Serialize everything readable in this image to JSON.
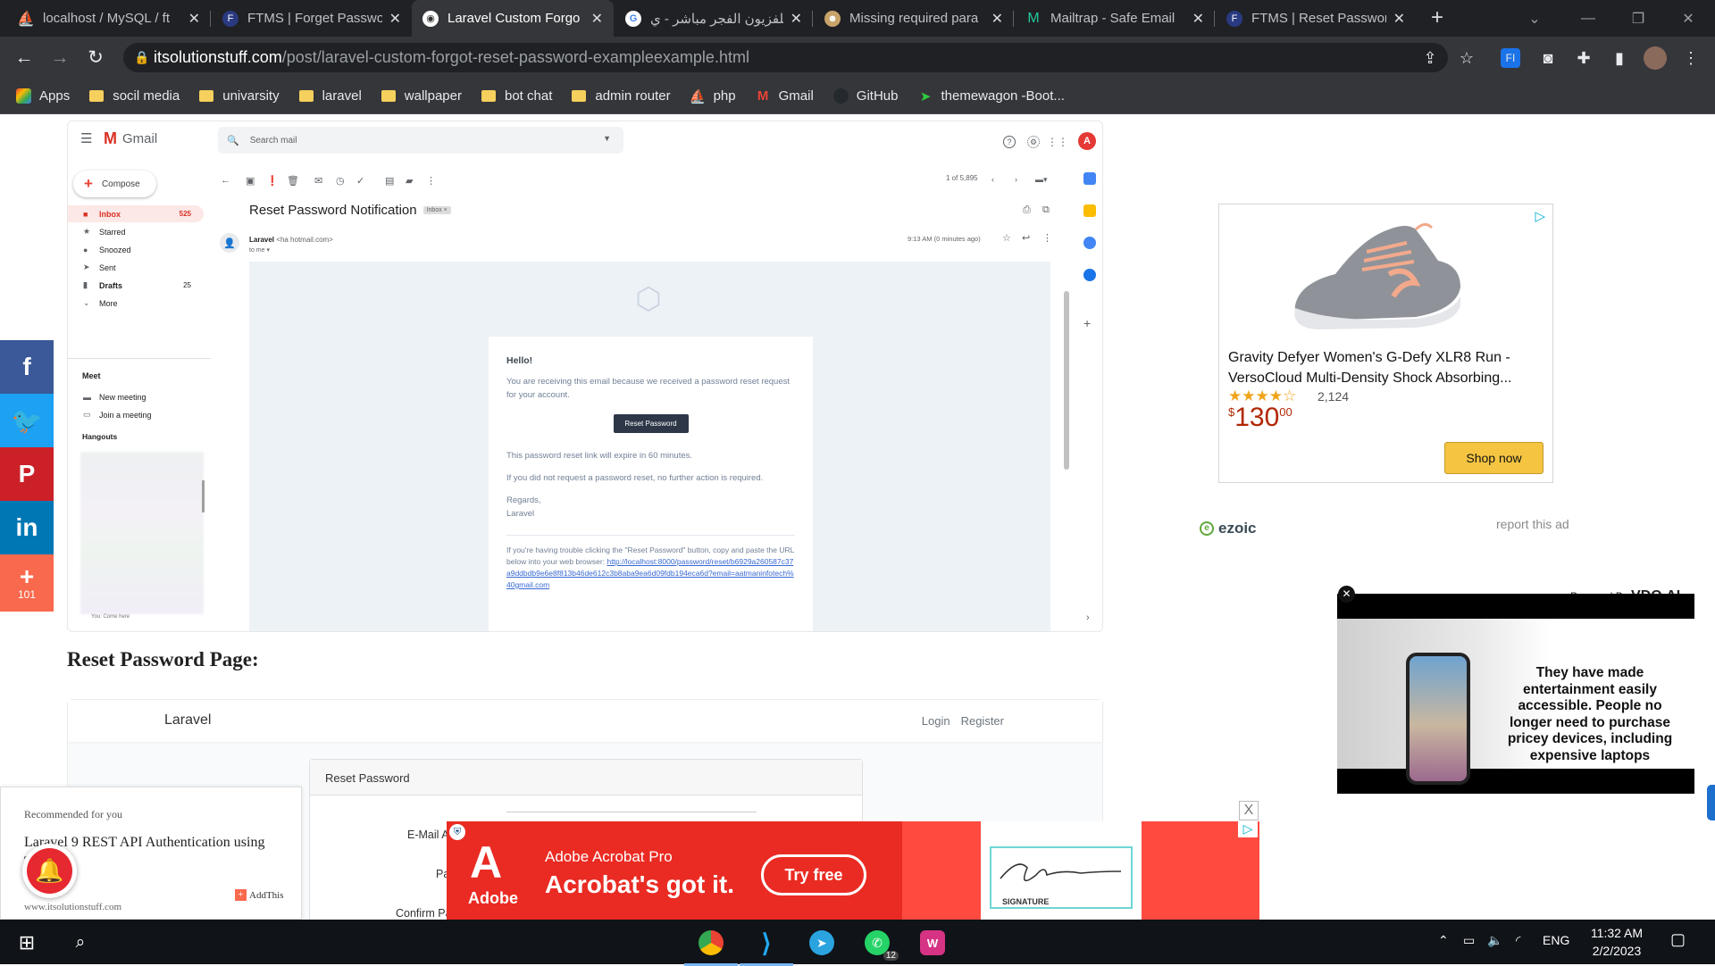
{
  "browser": {
    "tabs": [
      {
        "label": "localhost / MySQL / ft",
        "icon": "phpmyadmin-icon"
      },
      {
        "label": "FTMS | Forget Passwo",
        "icon": "ftms-icon"
      },
      {
        "label": "Laravel Custom Forgo",
        "icon": "itsolution-icon",
        "active": true
      },
      {
        "label": "تلفزيون الفجر مباشر - ي",
        "icon": "google-icon"
      },
      {
        "label": "Missing required para",
        "icon": "site-icon"
      },
      {
        "label": "Mailtrap - Safe Email",
        "icon": "mailtrap-icon"
      },
      {
        "label": "FTMS | Reset Passwor",
        "icon": "ftms-icon"
      }
    ],
    "url_host": "itsolutionstuff.com",
    "url_path": "/post/laravel-custom-forgot-reset-password-exampleexample.html",
    "bookmarks": [
      {
        "label": "Apps",
        "icon": "apps-grid-icon"
      },
      {
        "label": "socil media",
        "icon": "folder-icon"
      },
      {
        "label": "univarsity",
        "icon": "folder-icon"
      },
      {
        "label": "laravel",
        "icon": "folder-icon"
      },
      {
        "label": "wallpaper",
        "icon": "folder-icon"
      },
      {
        "label": "bot chat",
        "icon": "folder-icon"
      },
      {
        "label": "admin router",
        "icon": "folder-icon"
      },
      {
        "label": "php",
        "icon": "phpmyadmin-icon"
      },
      {
        "label": "Gmail",
        "icon": "gmail-icon"
      },
      {
        "label": "GitHub",
        "icon": "github-icon"
      },
      {
        "label": "themewagon -Boot...",
        "icon": "themewagon-icon"
      }
    ]
  },
  "share": {
    "plus_count": "101"
  },
  "gmail": {
    "app_name": "Gmail",
    "search_placeholder": "Search mail",
    "compose": "Compose",
    "nav": [
      {
        "label": "Inbox",
        "count": "525",
        "icon": "inbox-icon"
      },
      {
        "label": "Starred",
        "count": "",
        "icon": "star-icon"
      },
      {
        "label": "Snoozed",
        "count": "",
        "icon": "clock-icon"
      },
      {
        "label": "Sent",
        "count": "",
        "icon": "send-icon"
      },
      {
        "label": "Drafts",
        "count": "25",
        "icon": "draft-icon"
      },
      {
        "label": "More",
        "count": "",
        "icon": "chevron-down-icon"
      }
    ],
    "meet_title": "Meet",
    "meet_items": [
      "New meeting",
      "Join a meeting"
    ],
    "hangouts_title": "Hangouts",
    "hangouts_footer": "You: Come here",
    "pager": "1 of 5,895",
    "subject": "Reset Password Notification",
    "inbox_chip": "Inbox ×",
    "sender_name": "Laravel",
    "sender_addr": "<ha         hotmail.com>",
    "to": "to me ▾",
    "time": "9:13 AM (0 minutes ago)",
    "mail": {
      "greeting": "Hello!",
      "intro": "You are receiving this email because we received a password reset request for your account.",
      "button": "Reset Password",
      "expire": "This password reset link will expire in 60 minutes.",
      "noaction": "If you did not request a password reset, no further action is required.",
      "regards": "Regards,",
      "signoff": "Laravel",
      "subcopy": "If you're having trouble clicking the \"Reset Password\" button, copy and paste the URL below into your web browser:",
      "link": "http://localhost:8000/password/reset/b6929a260587c37a9ddbdb9e6e8f813b46de612c3b8aba9ea6d09fdb194eca6d?email=aatmaninfotech%40gmail.com"
    }
  },
  "article": {
    "heading": "Reset Password Page:",
    "preview_brand": "Laravel",
    "preview_login": "Login",
    "preview_register": "Register",
    "preview_card_title": "Reset Password",
    "preview_email_label": "E-Mail A",
    "preview_password_label": "Pa",
    "preview_confirm_label": "Confirm Pa"
  },
  "ad_shoe": {
    "title": "Gravity Defyer Women's G-Defy XLR8 Run - VersoCloud Multi-Density Shock Absorbing...",
    "rating": 3.5,
    "reviews": "2,124",
    "price_symbol": "$",
    "price_main": "130",
    "price_cents": "00",
    "cta": "Shop now",
    "network": "ezoic",
    "report": "report this ad"
  },
  "video_ad": {
    "powered_by": "Powered By",
    "brand": "VDO.AI",
    "text": "They have made entertainment easily accessible. People no longer need to purchase pricey devices, including expensive laptops"
  },
  "recommended": {
    "heading": "Recommended for you",
    "title": "Laravel 9 REST API Authentication using Tutorial",
    "source": "www.itsolutionstuff.com",
    "addthis": "AddThis"
  },
  "adobe_ad": {
    "brand": "Adobe",
    "product": "Adobe Acrobat Pro",
    "headline": "Acrobat's got it.",
    "cta": "Try free",
    "signature_label": "SIGNATURE",
    "close": "X"
  },
  "taskbar": {
    "lang": "ENG",
    "time": "11:32 AM",
    "date": "2/2/2023",
    "whatsapp_badge": "12"
  },
  "colors": {
    "facebook": "#3b5998",
    "twitter": "#1da1f2",
    "pinterest": "#cb2027",
    "linkedin": "#0077b5",
    "addthis": "#f8694d"
  }
}
